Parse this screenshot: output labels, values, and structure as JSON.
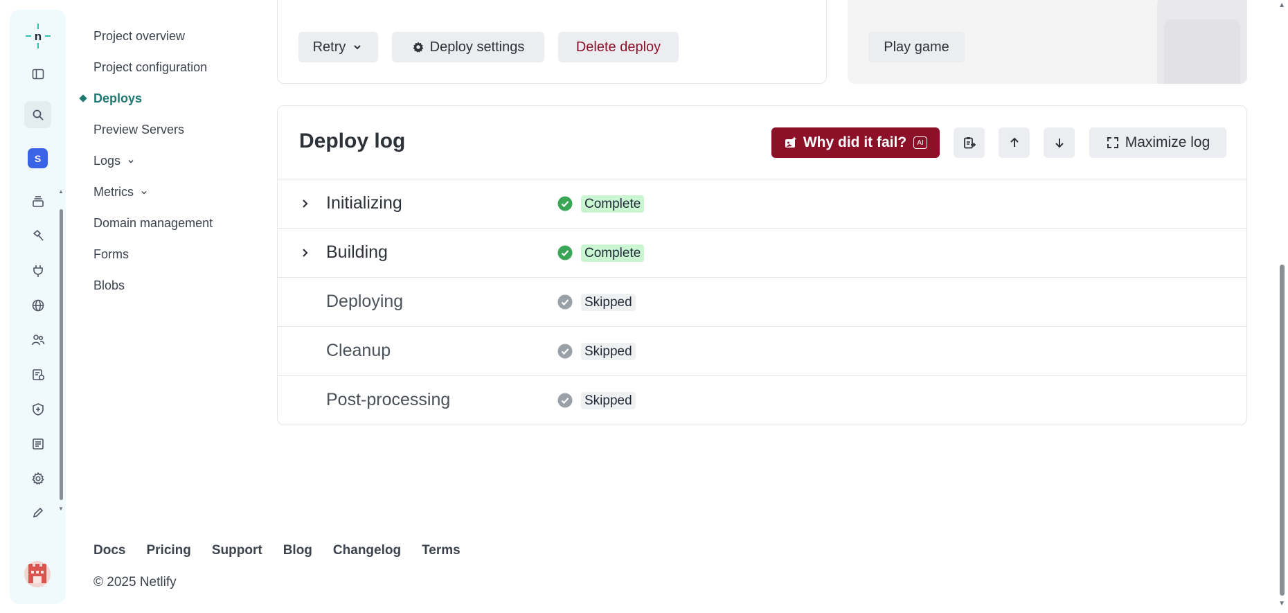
{
  "rail": {
    "team_initial": "S",
    "icons": [
      "sidebar-toggle-icon",
      "search-icon",
      "team-badge",
      "layers-icon",
      "hammer-icon",
      "plug-icon",
      "globe-icon",
      "users-icon",
      "billing-icon",
      "shield-icon",
      "docs-icon",
      "gear-icon",
      "pen-icon"
    ]
  },
  "nav": {
    "items": [
      {
        "label": "Project overview"
      },
      {
        "label": "Project configuration"
      },
      {
        "label": "Deploys"
      },
      {
        "label": "Preview Servers"
      },
      {
        "label": "Logs"
      },
      {
        "label": "Metrics"
      },
      {
        "label": "Domain management"
      },
      {
        "label": "Forms"
      },
      {
        "label": "Blobs"
      }
    ]
  },
  "actions": {
    "retry": "Retry",
    "deploy_settings": "Deploy settings",
    "delete_deploy": "Delete deploy",
    "play_game": "Play game"
  },
  "deploy_log": {
    "title": "Deploy log",
    "why_fail": "Why did it fail?",
    "ai_tag": "AI",
    "maximize": "Maximize log",
    "steps": [
      {
        "name": "Initializing",
        "status": "Complete"
      },
      {
        "name": "Building",
        "status": "Complete"
      },
      {
        "name": "Deploying",
        "status": "Skipped"
      },
      {
        "name": "Cleanup",
        "status": "Skipped"
      },
      {
        "name": "Post-processing",
        "status": "Skipped"
      }
    ]
  },
  "footer": {
    "links": [
      "Docs",
      "Pricing",
      "Support",
      "Blog",
      "Changelog",
      "Terms"
    ],
    "copyright": "© 2025 Netlify"
  },
  "colors": {
    "accent": "#1f7a73",
    "danger": "#8b1028",
    "complete_bg": "#c9f5d0",
    "complete_icon": "#3aa655",
    "skipped_icon": "#9aa0a8"
  }
}
